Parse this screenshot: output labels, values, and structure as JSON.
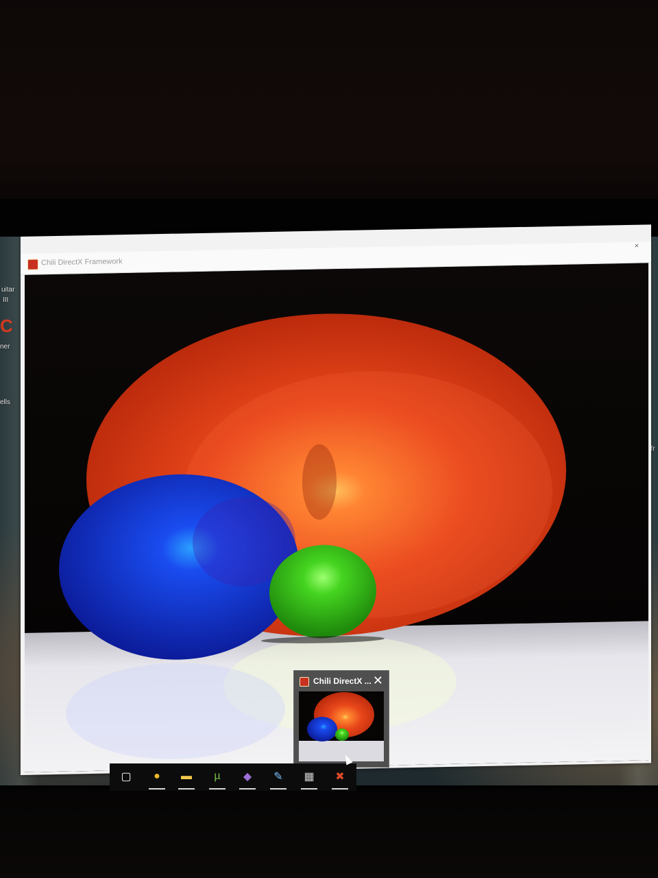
{
  "window": {
    "title": "Chili DirectX Framework",
    "close_glyph": "×"
  },
  "desktop": {
    "icon_labels": [
      "uitar",
      "III",
      "ner",
      "ells",
      "_fr"
    ],
    "left_icon_glyph": "C"
  },
  "taskbar": {
    "items": [
      {
        "name": "task-view-icon",
        "glyph": "▢"
      },
      {
        "name": "chrome-icon",
        "glyph": "●"
      },
      {
        "name": "file-explorer-icon",
        "glyph": "▬"
      },
      {
        "name": "utorrent-icon",
        "glyph": "µ"
      },
      {
        "name": "visual-studio-icon",
        "glyph": "◆"
      },
      {
        "name": "paint-icon",
        "glyph": "✎"
      },
      {
        "name": "calculator-icon",
        "glyph": "▦"
      },
      {
        "name": "chili-framework-icon",
        "glyph": "✖"
      }
    ]
  },
  "preview": {
    "title": "Chili DirectX ...",
    "close_glyph": "✕"
  },
  "colors": {
    "red_sphere": "#e23b12",
    "blue_sphere": "#1430d8",
    "green_sphere": "#3fc21a",
    "floor": "#e6e4e8",
    "taskbar": "#0c0c0c"
  }
}
